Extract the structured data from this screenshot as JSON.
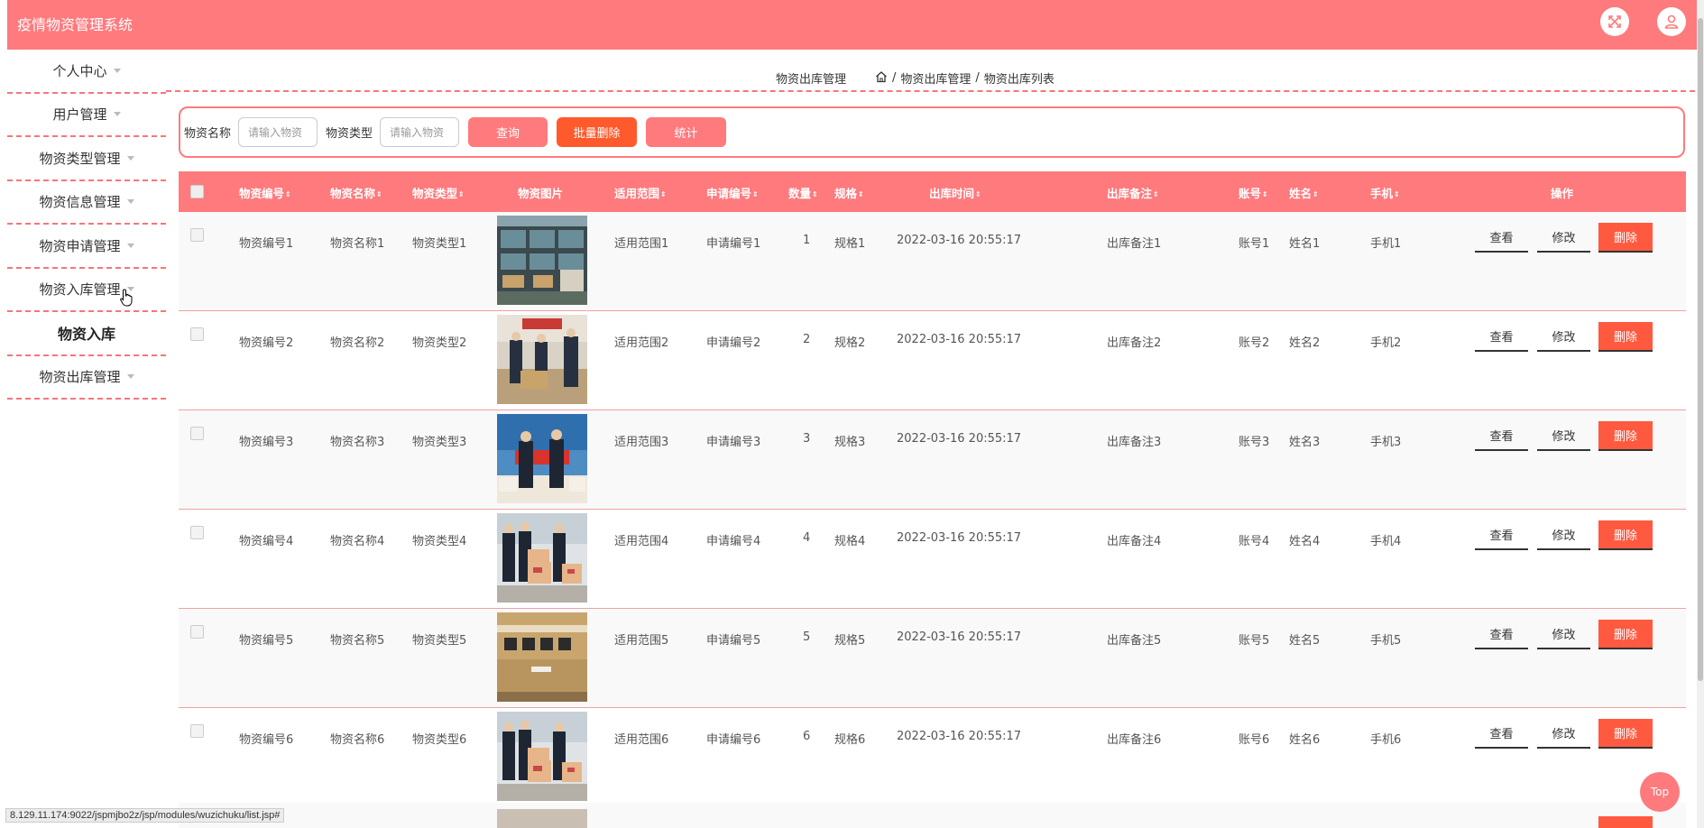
{
  "header": {
    "title": "疫情物资管理系统",
    "accent_color": "#fe7a7d",
    "icons": [
      "fullscreen-icon",
      "user-icon"
    ]
  },
  "sidebar": {
    "items": [
      {
        "label": "个人中心",
        "caret": true
      },
      {
        "label": "用户管理",
        "caret": true
      },
      {
        "label": "物资类型管理",
        "caret": true
      },
      {
        "label": "物资信息管理",
        "caret": true
      },
      {
        "label": "物资申请管理",
        "caret": true
      },
      {
        "label": "物资入库管理",
        "caret": true
      },
      {
        "label": "物资入库",
        "caret": false
      },
      {
        "label": "物资出库管理",
        "caret": true
      }
    ]
  },
  "breadcrumb": {
    "page_title": "物资出库管理",
    "path": [
      "物资出库管理",
      "物资出库列表"
    ],
    "separator": "/"
  },
  "filter": {
    "name_label": "物资名称",
    "name_placeholder": "请输入物资",
    "type_label": "物资类型",
    "type_placeholder": "请输入物资",
    "query_button": "查询",
    "batch_delete_button": "批量删除",
    "stats_button": "统计",
    "delete_color": "#ff5a2c"
  },
  "table": {
    "headers": {
      "code": "物资编号",
      "name": "物资名称",
      "type": "物资类型",
      "image": "物资图片",
      "scope": "适用范围",
      "apply_no": "申请编号",
      "qty": "数量",
      "spec": "规格",
      "out_time": "出库时间",
      "remark": "出库备注",
      "account": "账号",
      "person": "姓名",
      "phone": "手机",
      "ops": "操作"
    },
    "actions": {
      "view": "查看",
      "edit": "修改",
      "delete": "删除"
    },
    "rows": [
      {
        "code": "物资编号1",
        "name": "物资名称1",
        "type": "物资类型1",
        "scope": "适用范围1",
        "apply_no": "申请编号1",
        "qty": "1",
        "spec": "规格1",
        "out_time": "2022-03-16 20:55:17",
        "remark": "出库备注1",
        "account": "账号1",
        "person": "姓名1",
        "phone": "手机1",
        "image": "shelves-photo"
      },
      {
        "code": "物资编号2",
        "name": "物资名称2",
        "type": "物资类型2",
        "scope": "适用范围2",
        "apply_no": "申请编号2",
        "qty": "2",
        "spec": "规格2",
        "out_time": "2022-03-16 20:55:17",
        "remark": "出库备注2",
        "account": "账号2",
        "person": "姓名2",
        "phone": "手机2",
        "image": "donation-photo"
      },
      {
        "code": "物资编号3",
        "name": "物资名称3",
        "type": "物资类型3",
        "scope": "适用范围3",
        "apply_no": "申请编号3",
        "qty": "3",
        "spec": "规格3",
        "out_time": "2022-03-16 20:55:17",
        "remark": "出库备注3",
        "account": "账号3",
        "person": "姓名3",
        "phone": "手机3",
        "image": "ceremony-photo"
      },
      {
        "code": "物资编号4",
        "name": "物资名称4",
        "type": "物资类型4",
        "scope": "适用范围4",
        "apply_no": "申请编号4",
        "qty": "4",
        "spec": "规格4",
        "out_time": "2022-03-16 20:55:17",
        "remark": "出库备注4",
        "account": "账号4",
        "person": "姓名4",
        "phone": "手机4",
        "image": "boxes-people-photo"
      },
      {
        "code": "物资编号5",
        "name": "物资名称5",
        "type": "物资类型5",
        "scope": "适用范围5",
        "apply_no": "申请编号5",
        "qty": "5",
        "spec": "规格5",
        "out_time": "2022-03-16 20:55:17",
        "remark": "出库备注5",
        "account": "账号5",
        "person": "姓名5",
        "phone": "手机5",
        "image": "carton-photo"
      },
      {
        "code": "物资编号6",
        "name": "物资名称6",
        "type": "物资类型6",
        "scope": "适用范围6",
        "apply_no": "申请编号6",
        "qty": "6",
        "spec": "规格6",
        "out_time": "2022-03-16 20:55:17",
        "remark": "出库备注6",
        "account": "账号6",
        "person": "姓名6",
        "phone": "手机6",
        "image": "boxes-people-photo"
      }
    ]
  },
  "top_button": "Top",
  "status_url": "8.129.11.174:9022/jspmjbo2z/jsp/modules/wuzichuku/list.jsp#"
}
